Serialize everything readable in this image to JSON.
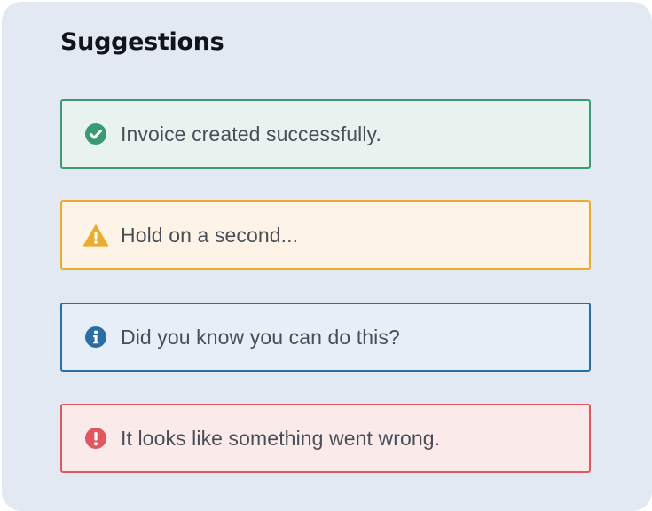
{
  "section": {
    "title": "Suggestions"
  },
  "alerts": [
    {
      "type": "success",
      "icon": "check-circle-icon",
      "message": "Invoice created successfully.",
      "color": "#3b9a72"
    },
    {
      "type": "warning",
      "icon": "warning-triangle-icon",
      "message": "Hold on a second...",
      "color": "#e9ac2f"
    },
    {
      "type": "info",
      "icon": "info-circle-icon",
      "message": "Did you know you can do this?",
      "color": "#2b6ea3"
    },
    {
      "type": "error",
      "icon": "exclamation-circle-icon",
      "message": "It looks like something went wrong.",
      "color": "#e0575f"
    }
  ]
}
